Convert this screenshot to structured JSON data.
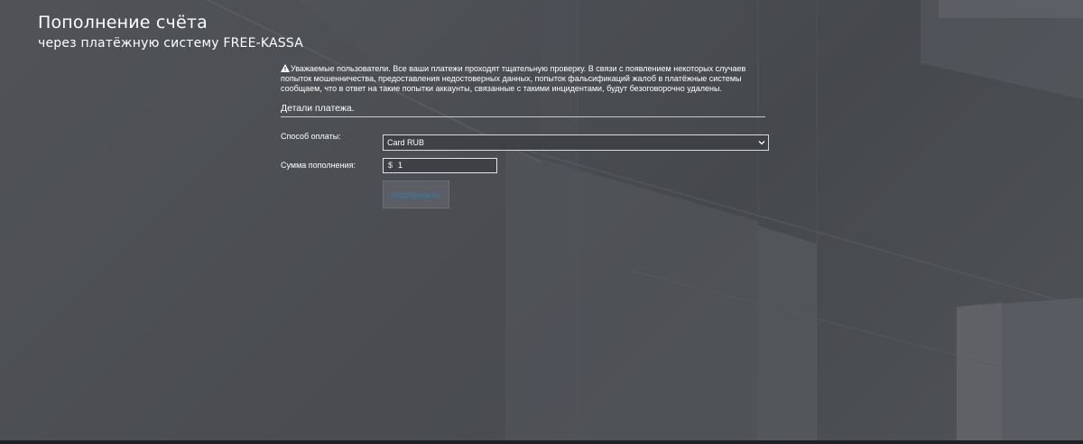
{
  "header": {
    "title": "Пополнение счёта",
    "subtitle": "через платёжную систему FREE-KASSA"
  },
  "notice": {
    "icon": "warning-icon",
    "text": "Уважаемые пользователи. Все ваши платежи проходят тщательную проверку. В связи с появлением некоторых случаев попыток мошенничества, предоставления недостоверных данных, попыток фальсификаций жалоб в платёжные системы сообщаем, что в ответ на такие попытки аккаунты, связанные с такими инцидентами, будут безоговорочно удалены."
  },
  "payment": {
    "section_title": "Детали платежа.",
    "method_label": "Способ оплаты:",
    "method_value": "Card RUB",
    "amount_label": "Сумма пополнения:",
    "currency_symbol": "$",
    "amount_value": "1",
    "submit_label": "ПОДТВЕРДИТЬ"
  },
  "colors": {
    "background": "#4a4d52",
    "button_text": "#2e7fb3",
    "button_bg": "#5b5f65"
  }
}
